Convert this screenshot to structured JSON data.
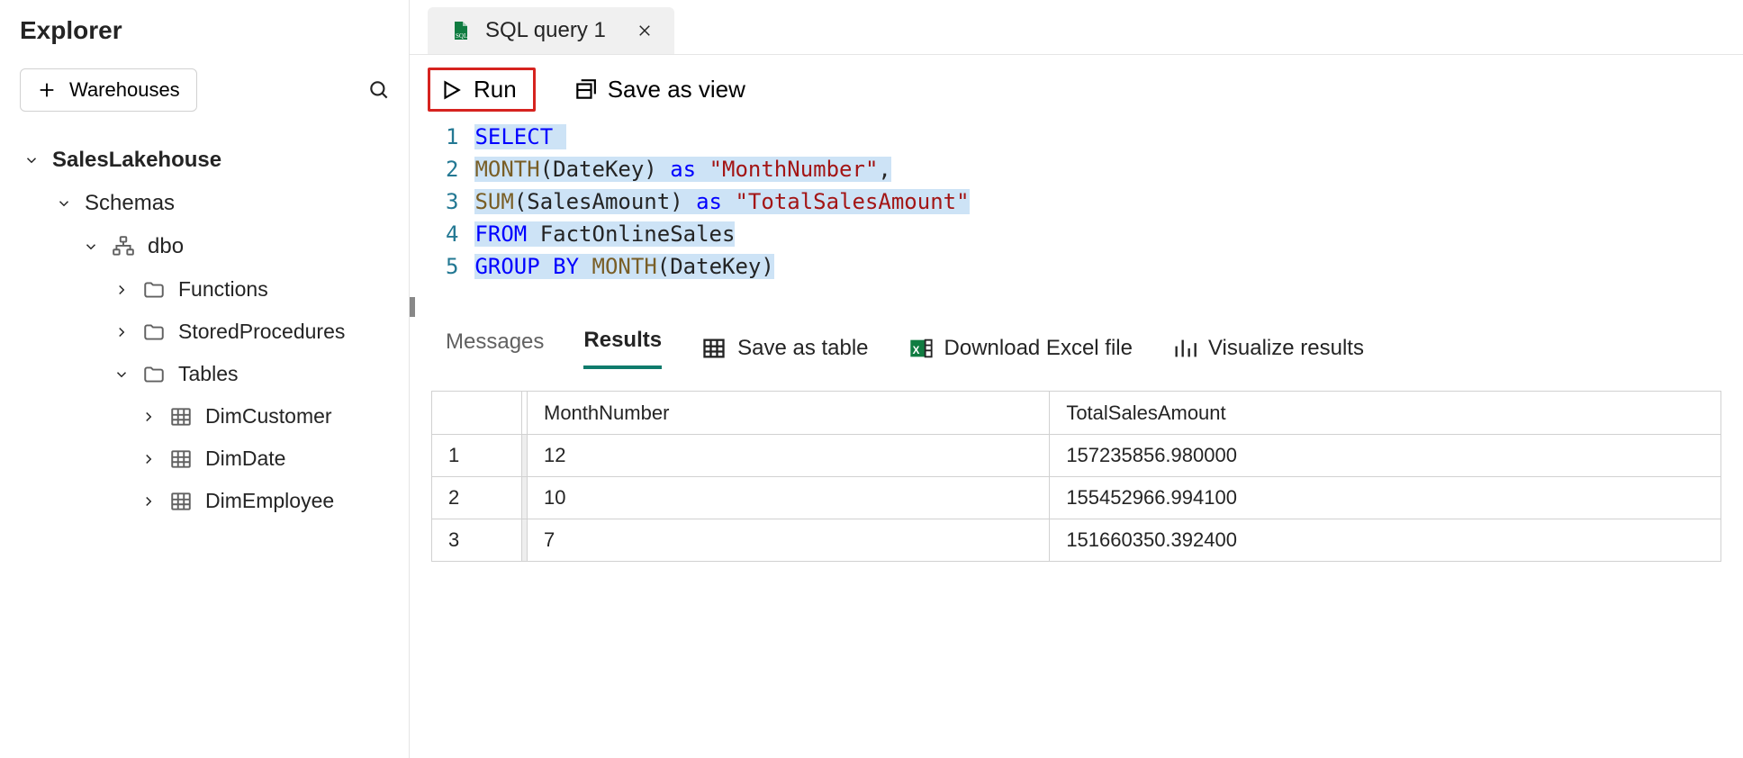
{
  "explorer": {
    "title": "Explorer",
    "warehouses_btn": "Warehouses",
    "tree": {
      "root": "SalesLakehouse",
      "schemas_label": "Schemas",
      "dbo_label": "dbo",
      "functions_label": "Functions",
      "sprocs_label": "StoredProcedures",
      "tables_label": "Tables",
      "tables": [
        "DimCustomer",
        "DimDate",
        "DimEmployee"
      ]
    }
  },
  "editor": {
    "tab_label": "SQL query 1",
    "run_label": "Run",
    "save_view_label": "Save as view",
    "code_lines": [
      {
        "selected": true,
        "display": "SELECT "
      },
      {
        "selected": true,
        "display": "MONTH(DateKey) as \"MonthNumber\","
      },
      {
        "selected": true,
        "display": "SUM(SalesAmount) as \"TotalSalesAmount\""
      },
      {
        "selected": true,
        "display": "FROM FactOnlineSales"
      },
      {
        "selected": true,
        "display": "GROUP BY MONTH(DateKey)"
      }
    ],
    "code_raw": "SELECT\nMONTH(DateKey) as \"MonthNumber\",\nSUM(SalesAmount) as \"TotalSalesAmount\"\nFROM FactOnlineSales\nGROUP BY MONTH(DateKey)"
  },
  "results": {
    "tab_messages": "Messages",
    "tab_results": "Results",
    "save_table": "Save as table",
    "download_excel": "Download Excel file",
    "visualize": "Visualize results",
    "columns": [
      "MonthNumber",
      "TotalSalesAmount"
    ],
    "rows": [
      {
        "n": "1",
        "MonthNumber": "12",
        "TotalSalesAmount": "157235856.980000"
      },
      {
        "n": "2",
        "MonthNumber": "10",
        "TotalSalesAmount": "155452966.994100"
      },
      {
        "n": "3",
        "MonthNumber": "7",
        "TotalSalesAmount": "151660350.392400"
      }
    ]
  }
}
